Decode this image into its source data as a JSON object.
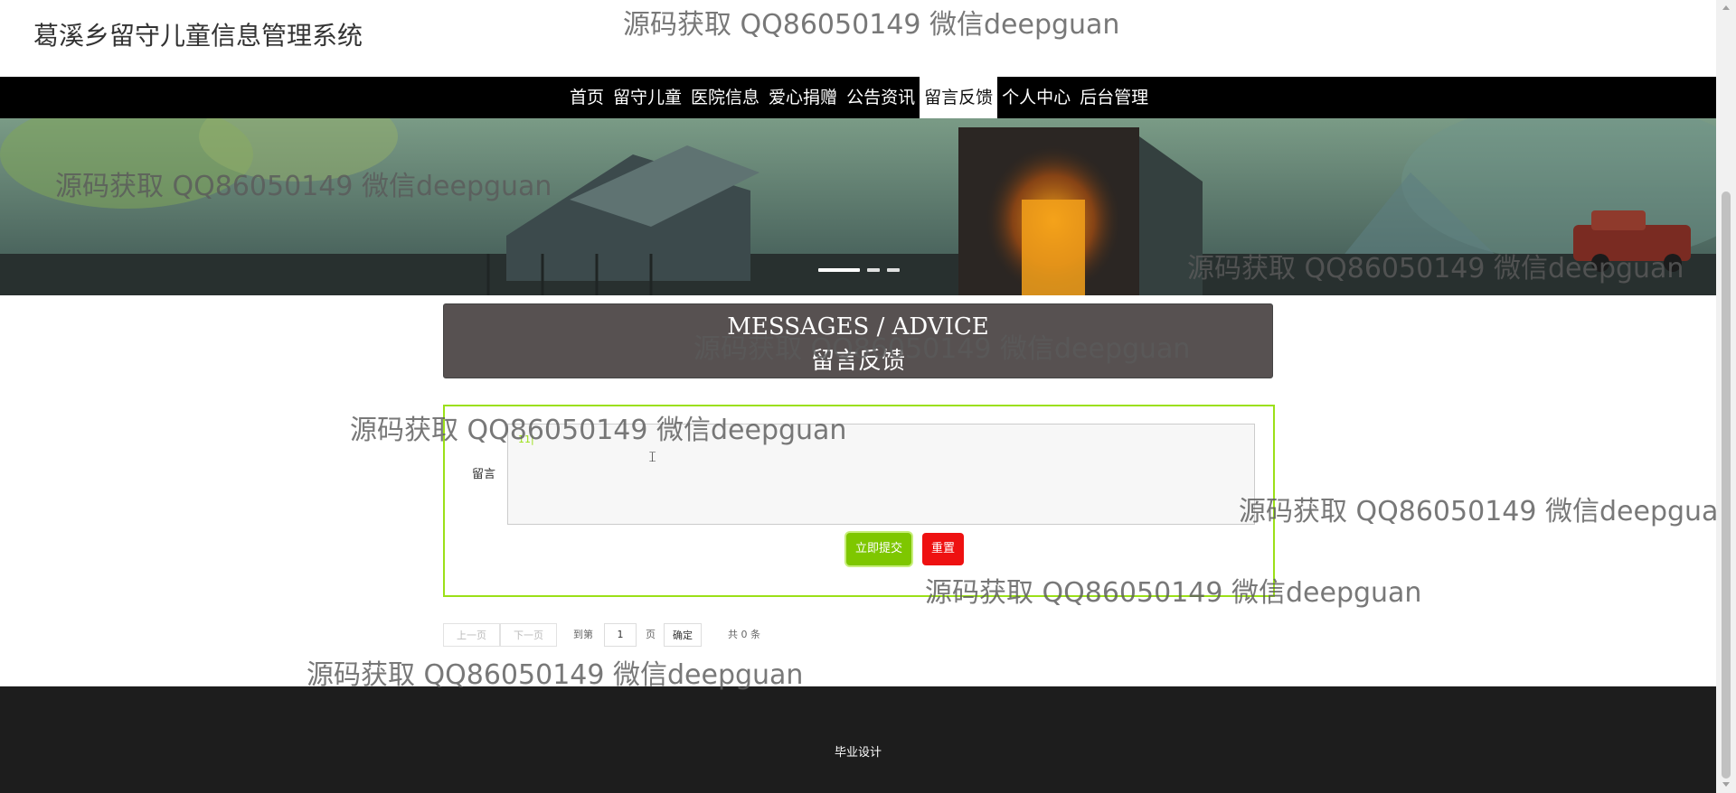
{
  "header": {
    "title": "葛溪乡留守儿童信息管理系统"
  },
  "nav": {
    "items": [
      {
        "label": "首页"
      },
      {
        "label": "留守儿童"
      },
      {
        "label": "医院信息"
      },
      {
        "label": "爱心捐赠"
      },
      {
        "label": "公告资讯"
      },
      {
        "label": "留言反馈"
      },
      {
        "label": "个人中心"
      },
      {
        "label": "后台管理"
      }
    ],
    "active_index": 5
  },
  "banner": {
    "slide_count": 3,
    "active_slide": 0
  },
  "section": {
    "title_en": "MESSAGES / ADVICE",
    "title_cn": "留言反馈"
  },
  "form": {
    "message_label": "留言",
    "message_value": "",
    "submit_label": "立即提交",
    "reset_label": "重置"
  },
  "pagination": {
    "prev_label": "上一页",
    "next_label": "下一页",
    "goto_label": "到第",
    "page_value": "1",
    "page_unit": "页",
    "confirm_label": "确定",
    "total_label": "共 0 条"
  },
  "footer": {
    "text": "毕业设计"
  },
  "watermark": {
    "text": "源码获取 QQ86050149 微信deepguan"
  },
  "colors": {
    "nav_bg": "#000000",
    "accent_green": "#7ec700",
    "form_border": "#9be018",
    "reset_red": "#ee1111",
    "title_box_bg": "#575151",
    "footer_bg": "#1d1d1d"
  }
}
